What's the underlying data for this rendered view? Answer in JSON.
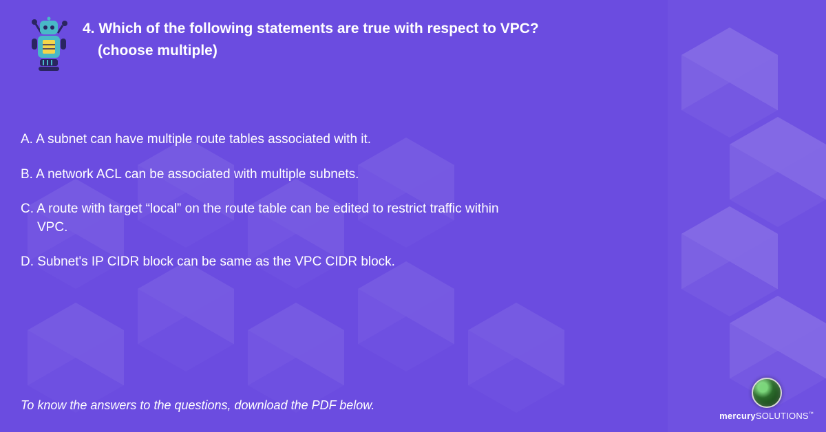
{
  "question": {
    "number": "4.",
    "line1": "Which of the following statements are true with respect to VPC?",
    "line2": "(choose multiple)"
  },
  "options": {
    "a": "A. A subnet can have multiple route tables associated with it.",
    "b": "B. A network ACL can be associated with multiple subnets.",
    "c_line1": "C. A route with target “local” on the route table can be edited to restrict traffic within",
    "c_line2": "VPC.",
    "d": "D. Subnet's IP CIDR block can be same as the VPC CIDR block."
  },
  "footer": "To know the answers to the questions, download the PDF below.",
  "brand": {
    "bold": "mercury",
    "light": "SOLUTIONS",
    "tm": "™"
  }
}
